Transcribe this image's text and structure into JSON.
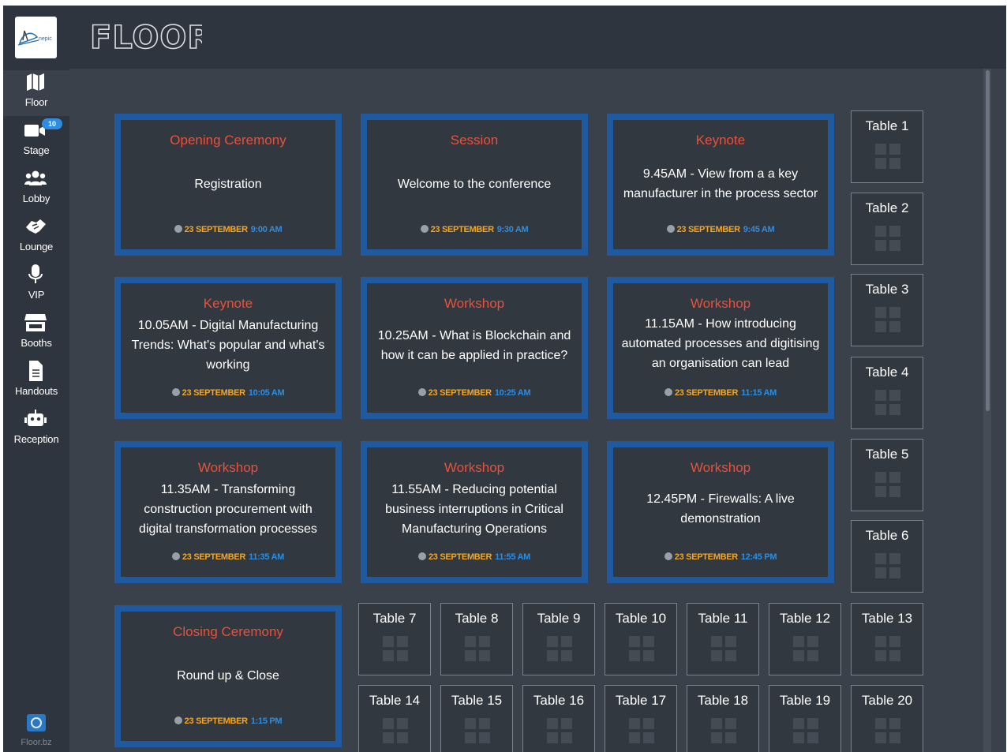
{
  "brand": {
    "logo_text": "nepic",
    "app_name": "FLOOR",
    "footer_label": "Floor.bz"
  },
  "nav": [
    {
      "label": "Floor",
      "icon": "map-icon",
      "active": true
    },
    {
      "label": "Stage",
      "icon": "video-camera-icon",
      "badge": "10"
    },
    {
      "label": "Lobby",
      "icon": "users-icon"
    },
    {
      "label": "Lounge",
      "icon": "handshake-icon"
    },
    {
      "label": "VIP",
      "icon": "microphone-icon"
    },
    {
      "label": "Booths",
      "icon": "store-icon"
    },
    {
      "label": "Handouts",
      "icon": "document-icon"
    },
    {
      "label": "Reception",
      "icon": "robot-icon"
    }
  ],
  "events": [
    {
      "type": "Opening Ceremony",
      "title": "Registration",
      "date": "23 SEPTEMBER",
      "time": "9:00 AM"
    },
    {
      "type": "Session",
      "title": "Welcome to the conference",
      "date": "23 SEPTEMBER",
      "time": "9:30 AM"
    },
    {
      "type": "Keynote",
      "title": "9.45AM - View from a a key manufacturer in the process sector",
      "date": "23 SEPTEMBER",
      "time": "9:45 AM"
    },
    {
      "type": "Keynote",
      "title": "10.05AM - Digital Manufacturing Trends: What's popular and what's working",
      "date": "23 SEPTEMBER",
      "time": "10:05 AM"
    },
    {
      "type": "Workshop",
      "title": "10.25AM - What is Blockchain and how it can be applied in practice?",
      "date": "23 SEPTEMBER",
      "time": "10:25 AM"
    },
    {
      "type": "Workshop",
      "title": "11.15AM - How introducing automated processes and digitising an organisation can lead",
      "date": "23 SEPTEMBER",
      "time": "11:15 AM"
    },
    {
      "type": "Workshop",
      "title": "11.35AM - Transforming construction procurement with digital transformation processes",
      "date": "23 SEPTEMBER",
      "time": "11:35 AM"
    },
    {
      "type": "Workshop",
      "title": "11.55AM - Reducing potential business interruptions in Critical Manufacturing Operations",
      "date": "23 SEPTEMBER",
      "time": "11:55 AM"
    },
    {
      "type": "Workshop",
      "title": "12.45PM - Firewalls: A live demonstration",
      "date": "23 SEPTEMBER",
      "time": "12:45 PM"
    },
    {
      "type": "Closing Ceremony",
      "title": "Round up & Close",
      "date": "23 SEPTEMBER",
      "time": "1:15 PM"
    }
  ],
  "tables": [
    "Table 1",
    "Table 2",
    "Table 3",
    "Table 4",
    "Table 5",
    "Table 6",
    "Table 7",
    "Table 8",
    "Table 9",
    "Table 10",
    "Table 11",
    "Table 12",
    "Table 13",
    "Table 14",
    "Table 15",
    "Table 16",
    "Table 17",
    "Table 18",
    "Table 19",
    "Table 20"
  ]
}
